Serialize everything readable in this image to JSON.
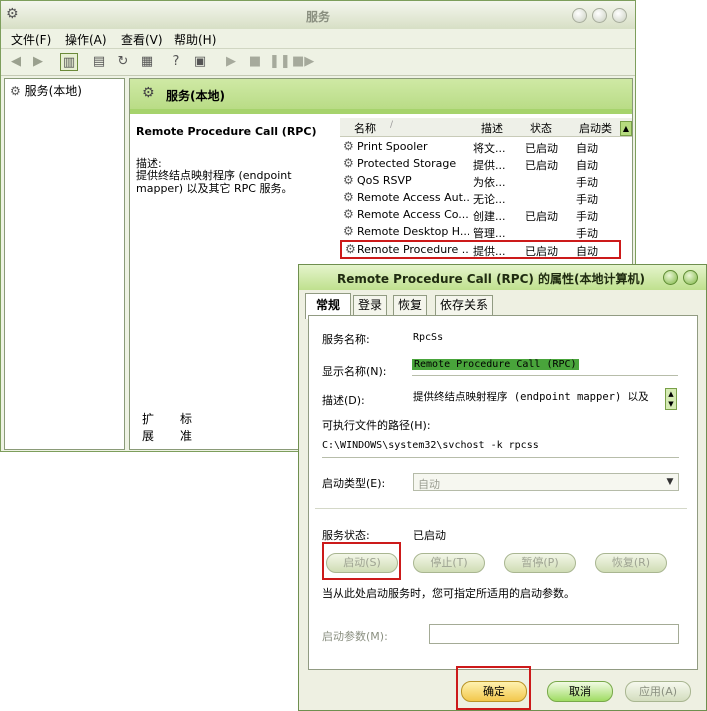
{
  "services_window": {
    "title": "服务",
    "menu": [
      "文件(F)",
      "操作(A)",
      "查看(V)",
      "帮助(H)"
    ],
    "tree_item": "服务(本地)",
    "pane_header": "服务(本地)",
    "detail": {
      "service_title": "Remote Procedure Call (RPC)",
      "desc_label": "描述:",
      "desc_text": "提供终结点映射程序 (endpoint mapper) 以及其它 RPC 服务。"
    },
    "list_columns": [
      "名称",
      "描述",
      "状态",
      "启动类"
    ],
    "rows": [
      {
        "name": "Print Spooler",
        "desc": "将文...",
        "status": "已启动",
        "startup": "自动"
      },
      {
        "name": "Protected Storage",
        "desc": "提供...",
        "status": "已启动",
        "startup": "自动"
      },
      {
        "name": "QoS RSVP",
        "desc": "为依...",
        "status": "",
        "startup": "手动"
      },
      {
        "name": "Remote Access Aut...",
        "desc": "无论...",
        "status": "",
        "startup": "手动"
      },
      {
        "name": "Remote Access Co...",
        "desc": "创建...",
        "status": "已启动",
        "startup": "手动"
      },
      {
        "name": "Remote Desktop H...",
        "desc": "管理...",
        "status": "",
        "startup": "手动"
      },
      {
        "name": "Remote Procedure ...",
        "desc": "提供...",
        "status": "已启动",
        "startup": "自动"
      }
    ],
    "bottom_tabs": [
      "扩展",
      "标准"
    ]
  },
  "dialog": {
    "title": "Remote Procedure Call (RPC) 的属性(本地计算机)",
    "tabs": [
      "常规",
      "登录",
      "恢复",
      "依存关系"
    ],
    "service_name_label": "服务名称:",
    "service_name": "RpcSs",
    "display_name_label": "显示名称(N):",
    "display_name": "Remote Procedure Call (RPC)",
    "description_label": "描述(D):",
    "description": "提供终结点映射程序 (endpoint mapper) 以及",
    "exec_path_label": "可执行文件的路径(H):",
    "exec_path": "C:\\WINDOWS\\system32\\svchost -k rpcss",
    "startup_type_label": "启动类型(E):",
    "startup_type": "自动",
    "status_label": "服务状态:",
    "status_value": "已启动",
    "buttons": {
      "start": "启动(S)",
      "stop": "停止(T)",
      "pause": "暂停(P)",
      "resume": "恢复(R)"
    },
    "hint": "当从此处启动服务时，您可指定所适用的启动参数。",
    "param_label": "启动参数(M):",
    "ok": "确定",
    "cancel": "取消",
    "apply": "应用(A)"
  },
  "colors": {
    "highlight": "#cc1a1a",
    "accent_green": "#a6d36c",
    "selected_name": "#49a43b"
  }
}
